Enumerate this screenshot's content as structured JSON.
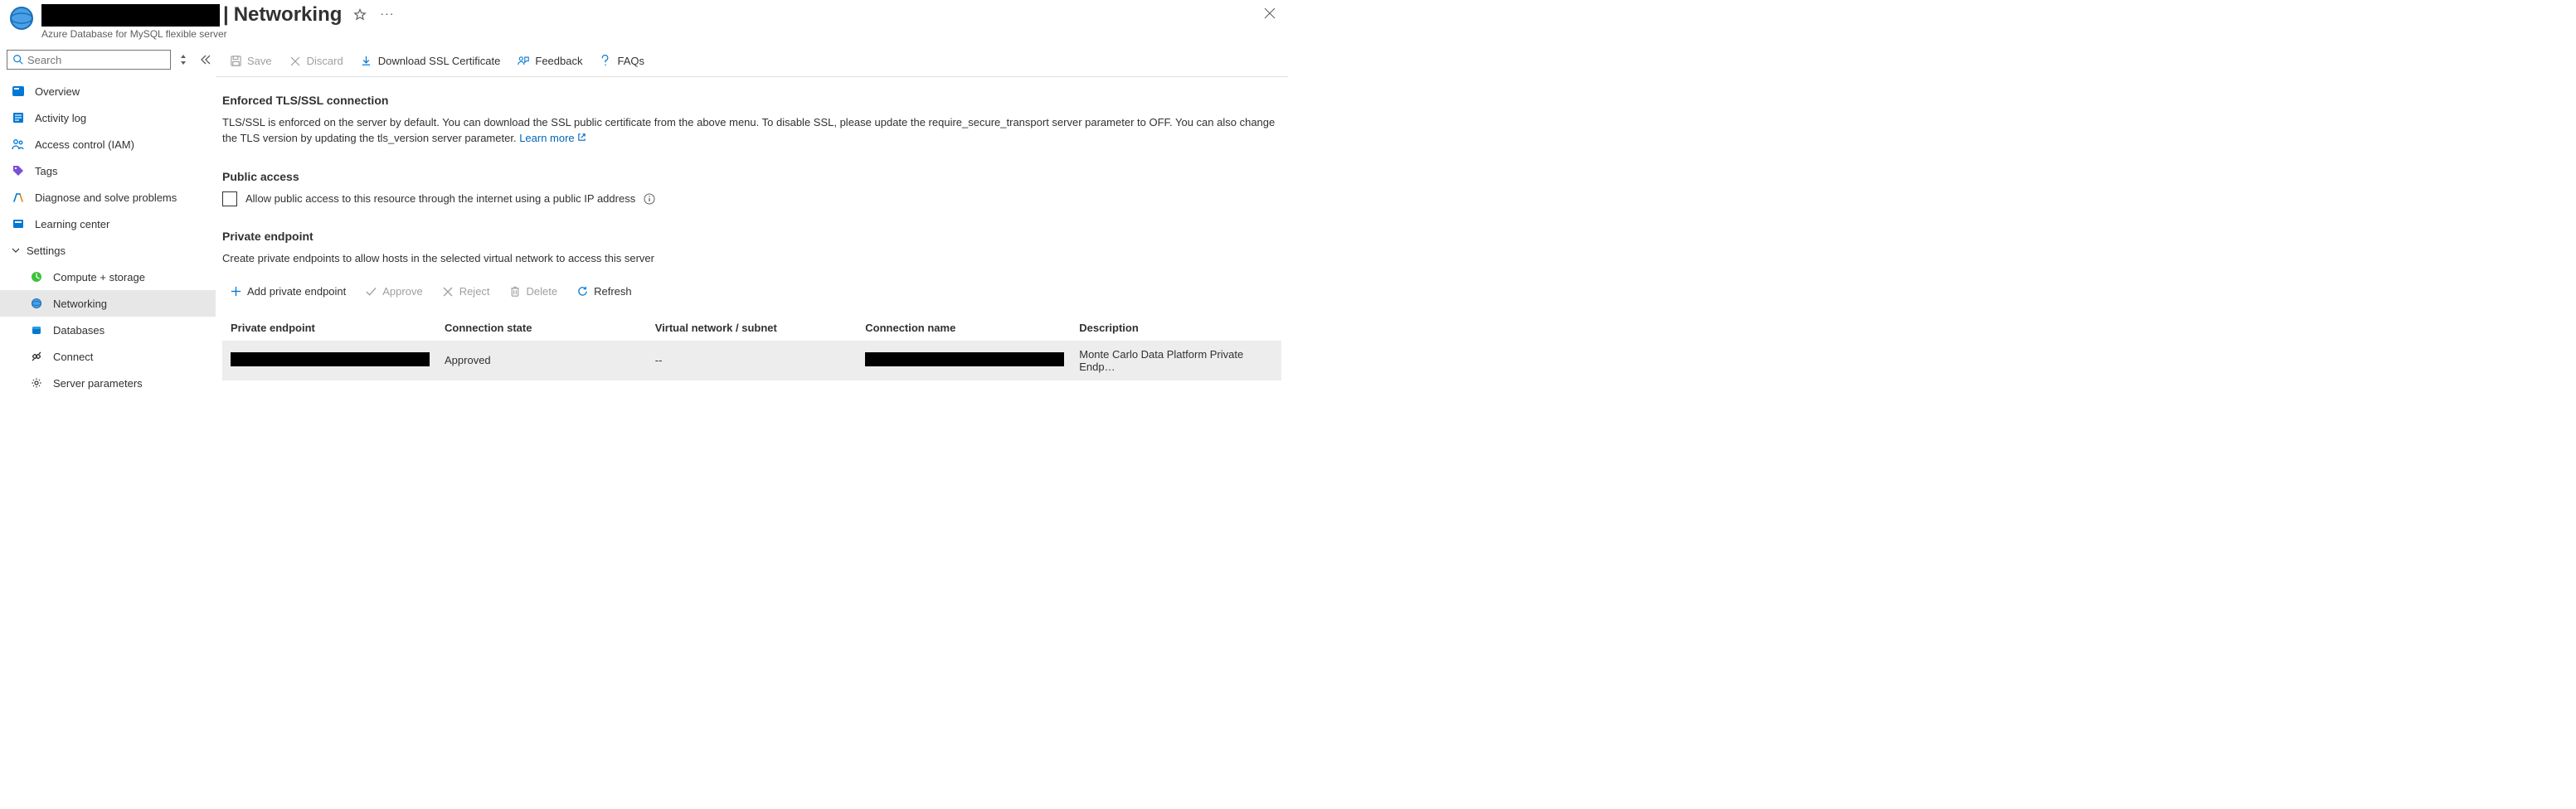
{
  "header": {
    "page_title": "Networking",
    "subtitle": "Azure Database for MySQL flexible server",
    "separator": "|"
  },
  "search": {
    "placeholder": "Search"
  },
  "sidebar": {
    "items": [
      {
        "label": "Overview"
      },
      {
        "label": "Activity log"
      },
      {
        "label": "Access control (IAM)"
      },
      {
        "label": "Tags"
      },
      {
        "label": "Diagnose and solve problems"
      },
      {
        "label": "Learning center"
      }
    ],
    "section_header": "Settings",
    "settings": [
      {
        "label": "Compute + storage"
      },
      {
        "label": "Networking"
      },
      {
        "label": "Databases"
      },
      {
        "label": "Connect"
      },
      {
        "label": "Server parameters"
      }
    ]
  },
  "toolbar": {
    "save": "Save",
    "discard": "Discard",
    "download_ssl": "Download SSL Certificate",
    "feedback": "Feedback",
    "faqs": "FAQs"
  },
  "tls": {
    "title": "Enforced TLS/SSL connection",
    "body": "TLS/SSL is enforced on the server by default. You can download the SSL public certificate from the above menu. To disable SSL, please update the require_secure_transport server parameter to OFF. You can also change the TLS version by updating the tls_version server parameter.",
    "learn_more": "Learn more"
  },
  "public_access": {
    "title": "Public access",
    "checkbox_label": "Allow public access to this resource through the internet using a public IP address"
  },
  "private_endpoint": {
    "title": "Private endpoint",
    "desc": "Create private endpoints to allow hosts in the selected virtual network to access this server",
    "actions": {
      "add": "Add private endpoint",
      "approve": "Approve",
      "reject": "Reject",
      "delete": "Delete",
      "refresh": "Refresh"
    },
    "table": {
      "headers": {
        "endpoint": "Private endpoint",
        "state": "Connection state",
        "vnet": "Virtual network / subnet",
        "conn_name": "Connection name",
        "desc": "Description"
      },
      "rows": [
        {
          "state": "Approved",
          "vnet": "--",
          "desc": "Monte Carlo Data Platform Private Endp…"
        }
      ]
    }
  }
}
